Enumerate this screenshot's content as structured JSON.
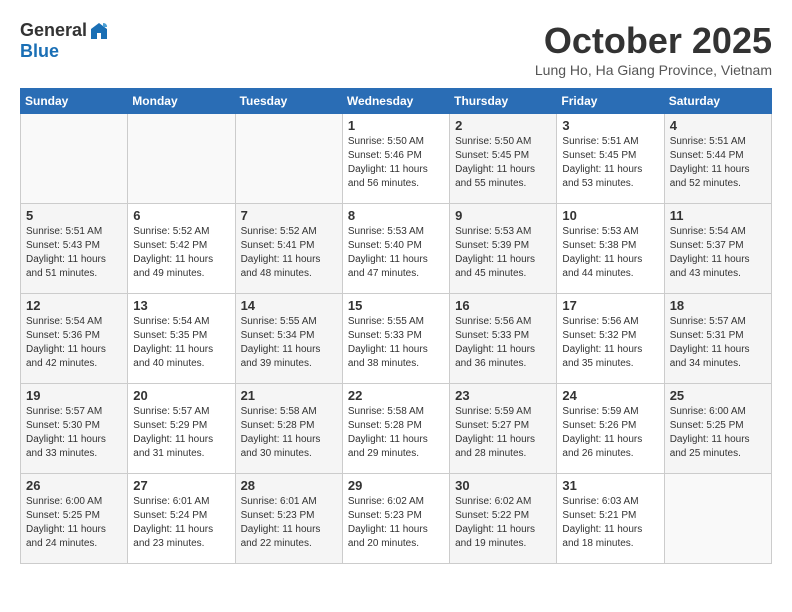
{
  "logo": {
    "general": "General",
    "blue": "Blue"
  },
  "title": "October 2025",
  "location": "Lung Ho, Ha Giang Province, Vietnam",
  "weekdays": [
    "Sunday",
    "Monday",
    "Tuesday",
    "Wednesday",
    "Thursday",
    "Friday",
    "Saturday"
  ],
  "weeks": [
    [
      {
        "day": "",
        "info": ""
      },
      {
        "day": "",
        "info": ""
      },
      {
        "day": "",
        "info": ""
      },
      {
        "day": "1",
        "info": "Sunrise: 5:50 AM\nSunset: 5:46 PM\nDaylight: 11 hours and 56 minutes."
      },
      {
        "day": "2",
        "info": "Sunrise: 5:50 AM\nSunset: 5:45 PM\nDaylight: 11 hours and 55 minutes."
      },
      {
        "day": "3",
        "info": "Sunrise: 5:51 AM\nSunset: 5:45 PM\nDaylight: 11 hours and 53 minutes."
      },
      {
        "day": "4",
        "info": "Sunrise: 5:51 AM\nSunset: 5:44 PM\nDaylight: 11 hours and 52 minutes."
      }
    ],
    [
      {
        "day": "5",
        "info": "Sunrise: 5:51 AM\nSunset: 5:43 PM\nDaylight: 11 hours and 51 minutes."
      },
      {
        "day": "6",
        "info": "Sunrise: 5:52 AM\nSunset: 5:42 PM\nDaylight: 11 hours and 49 minutes."
      },
      {
        "day": "7",
        "info": "Sunrise: 5:52 AM\nSunset: 5:41 PM\nDaylight: 11 hours and 48 minutes."
      },
      {
        "day": "8",
        "info": "Sunrise: 5:53 AM\nSunset: 5:40 PM\nDaylight: 11 hours and 47 minutes."
      },
      {
        "day": "9",
        "info": "Sunrise: 5:53 AM\nSunset: 5:39 PM\nDaylight: 11 hours and 45 minutes."
      },
      {
        "day": "10",
        "info": "Sunrise: 5:53 AM\nSunset: 5:38 PM\nDaylight: 11 hours and 44 minutes."
      },
      {
        "day": "11",
        "info": "Sunrise: 5:54 AM\nSunset: 5:37 PM\nDaylight: 11 hours and 43 minutes."
      }
    ],
    [
      {
        "day": "12",
        "info": "Sunrise: 5:54 AM\nSunset: 5:36 PM\nDaylight: 11 hours and 42 minutes."
      },
      {
        "day": "13",
        "info": "Sunrise: 5:54 AM\nSunset: 5:35 PM\nDaylight: 11 hours and 40 minutes."
      },
      {
        "day": "14",
        "info": "Sunrise: 5:55 AM\nSunset: 5:34 PM\nDaylight: 11 hours and 39 minutes."
      },
      {
        "day": "15",
        "info": "Sunrise: 5:55 AM\nSunset: 5:33 PM\nDaylight: 11 hours and 38 minutes."
      },
      {
        "day": "16",
        "info": "Sunrise: 5:56 AM\nSunset: 5:33 PM\nDaylight: 11 hours and 36 minutes."
      },
      {
        "day": "17",
        "info": "Sunrise: 5:56 AM\nSunset: 5:32 PM\nDaylight: 11 hours and 35 minutes."
      },
      {
        "day": "18",
        "info": "Sunrise: 5:57 AM\nSunset: 5:31 PM\nDaylight: 11 hours and 34 minutes."
      }
    ],
    [
      {
        "day": "19",
        "info": "Sunrise: 5:57 AM\nSunset: 5:30 PM\nDaylight: 11 hours and 33 minutes."
      },
      {
        "day": "20",
        "info": "Sunrise: 5:57 AM\nSunset: 5:29 PM\nDaylight: 11 hours and 31 minutes."
      },
      {
        "day": "21",
        "info": "Sunrise: 5:58 AM\nSunset: 5:28 PM\nDaylight: 11 hours and 30 minutes."
      },
      {
        "day": "22",
        "info": "Sunrise: 5:58 AM\nSunset: 5:28 PM\nDaylight: 11 hours and 29 minutes."
      },
      {
        "day": "23",
        "info": "Sunrise: 5:59 AM\nSunset: 5:27 PM\nDaylight: 11 hours and 28 minutes."
      },
      {
        "day": "24",
        "info": "Sunrise: 5:59 AM\nSunset: 5:26 PM\nDaylight: 11 hours and 26 minutes."
      },
      {
        "day": "25",
        "info": "Sunrise: 6:00 AM\nSunset: 5:25 PM\nDaylight: 11 hours and 25 minutes."
      }
    ],
    [
      {
        "day": "26",
        "info": "Sunrise: 6:00 AM\nSunset: 5:25 PM\nDaylight: 11 hours and 24 minutes."
      },
      {
        "day": "27",
        "info": "Sunrise: 6:01 AM\nSunset: 5:24 PM\nDaylight: 11 hours and 23 minutes."
      },
      {
        "day": "28",
        "info": "Sunrise: 6:01 AM\nSunset: 5:23 PM\nDaylight: 11 hours and 22 minutes."
      },
      {
        "day": "29",
        "info": "Sunrise: 6:02 AM\nSunset: 5:23 PM\nDaylight: 11 hours and 20 minutes."
      },
      {
        "day": "30",
        "info": "Sunrise: 6:02 AM\nSunset: 5:22 PM\nDaylight: 11 hours and 19 minutes."
      },
      {
        "day": "31",
        "info": "Sunrise: 6:03 AM\nSunset: 5:21 PM\nDaylight: 11 hours and 18 minutes."
      },
      {
        "day": "",
        "info": ""
      }
    ]
  ]
}
